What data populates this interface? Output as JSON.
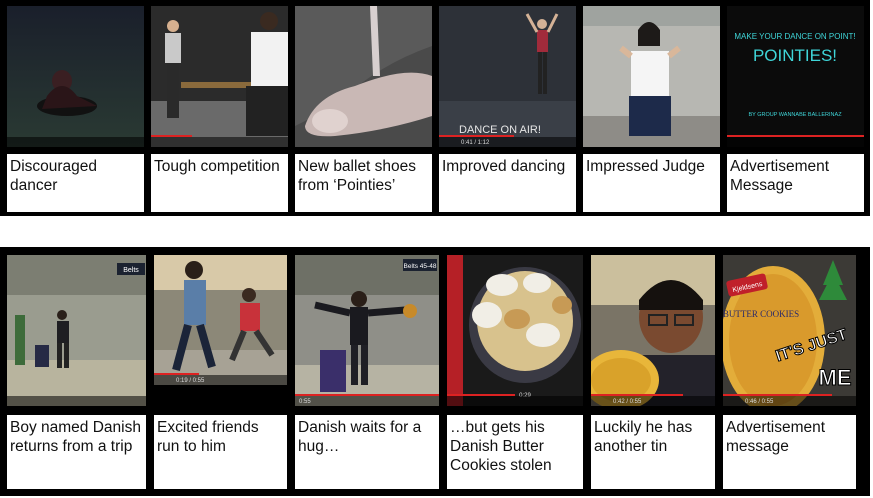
{
  "row1": [
    {
      "caption": "Discouraged dancer"
    },
    {
      "caption": "Tough competition"
    },
    {
      "caption": "New ballet shoes from ‘Pointies’"
    },
    {
      "caption": "Improved dancing",
      "overlay": "DANCE ON AIR!",
      "timecode": "0:41 / 1:12"
    },
    {
      "caption": "Impressed Judge"
    },
    {
      "caption": "Advertisement Message",
      "ad_line1": "MAKE YOUR DANCE ON POINT!",
      "ad_brand": "POINTIES!",
      "ad_credit": "BY GROUP WANNABE BALLERINAZ"
    }
  ],
  "row2": [
    {
      "caption": "Boy named Danish returns from a trip",
      "sign": "Belts"
    },
    {
      "caption": "Excited friends run to him",
      "timecode": "0:19 / 0:55"
    },
    {
      "caption": "Danish waits for a hug…",
      "sign": "Belts 45-48",
      "timecode": "0:55"
    },
    {
      "caption": "…but gets his Danish Butter Cookies stolen",
      "timecode": "0:29"
    },
    {
      "caption": "Luckily he has another tin",
      "timecode": "0:42 / 0:55"
    },
    {
      "caption": "Advertisement message",
      "tin_brand": "Kjeldsens",
      "tin_text": "BUTTER COOKIES",
      "slogan": "IT'S JUST",
      "slogan2": "ME",
      "timecode": "0:46 / 0:55"
    }
  ]
}
